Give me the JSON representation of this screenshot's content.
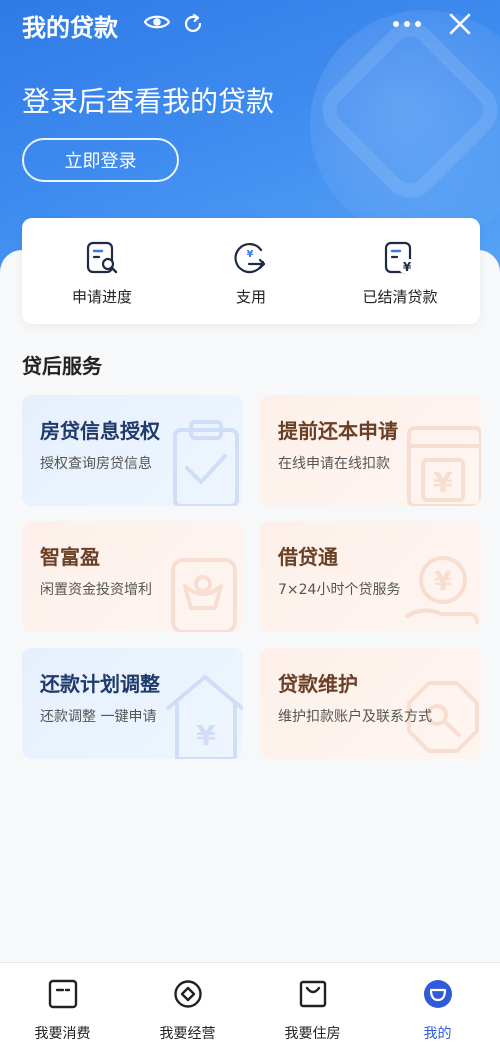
{
  "header": {
    "title": "我的贷款",
    "login_prompt": "登录后查看我的贷款",
    "login_button": "立即登录"
  },
  "quick_actions": [
    {
      "label": "申请进度",
      "icon": "document-search-icon"
    },
    {
      "label": "支用",
      "icon": "yuan-transfer-icon"
    },
    {
      "label": "已结清贷款",
      "icon": "document-yuan-icon"
    }
  ],
  "section": {
    "title": "贷后服务"
  },
  "services": [
    {
      "name": "房贷信息授权",
      "desc": "授权查询房贷信息"
    },
    {
      "name": "提前还本申请",
      "desc": "在线申请在线扣款"
    },
    {
      "name": "智富盈",
      "desc": "闲置资金投资增利"
    },
    {
      "name": "借贷通",
      "desc": "7×24小时个贷服务"
    },
    {
      "name": "还款计划调整",
      "desc": "还款调整 一键申请"
    },
    {
      "name": "贷款维护",
      "desc": "维护扣款账户及联系方式"
    }
  ],
  "tabbar": {
    "active_index": 3,
    "tabs": [
      {
        "label": "我要消费"
      },
      {
        "label": "我要经营"
      },
      {
        "label": "我要住房"
      },
      {
        "label": "我的"
      }
    ]
  },
  "colors": {
    "brand_blue": "#2f7ae6",
    "active_tab": "#2f5ad8",
    "card_blue": "#e6f0fd",
    "card_peach": "#fdf0ea"
  }
}
